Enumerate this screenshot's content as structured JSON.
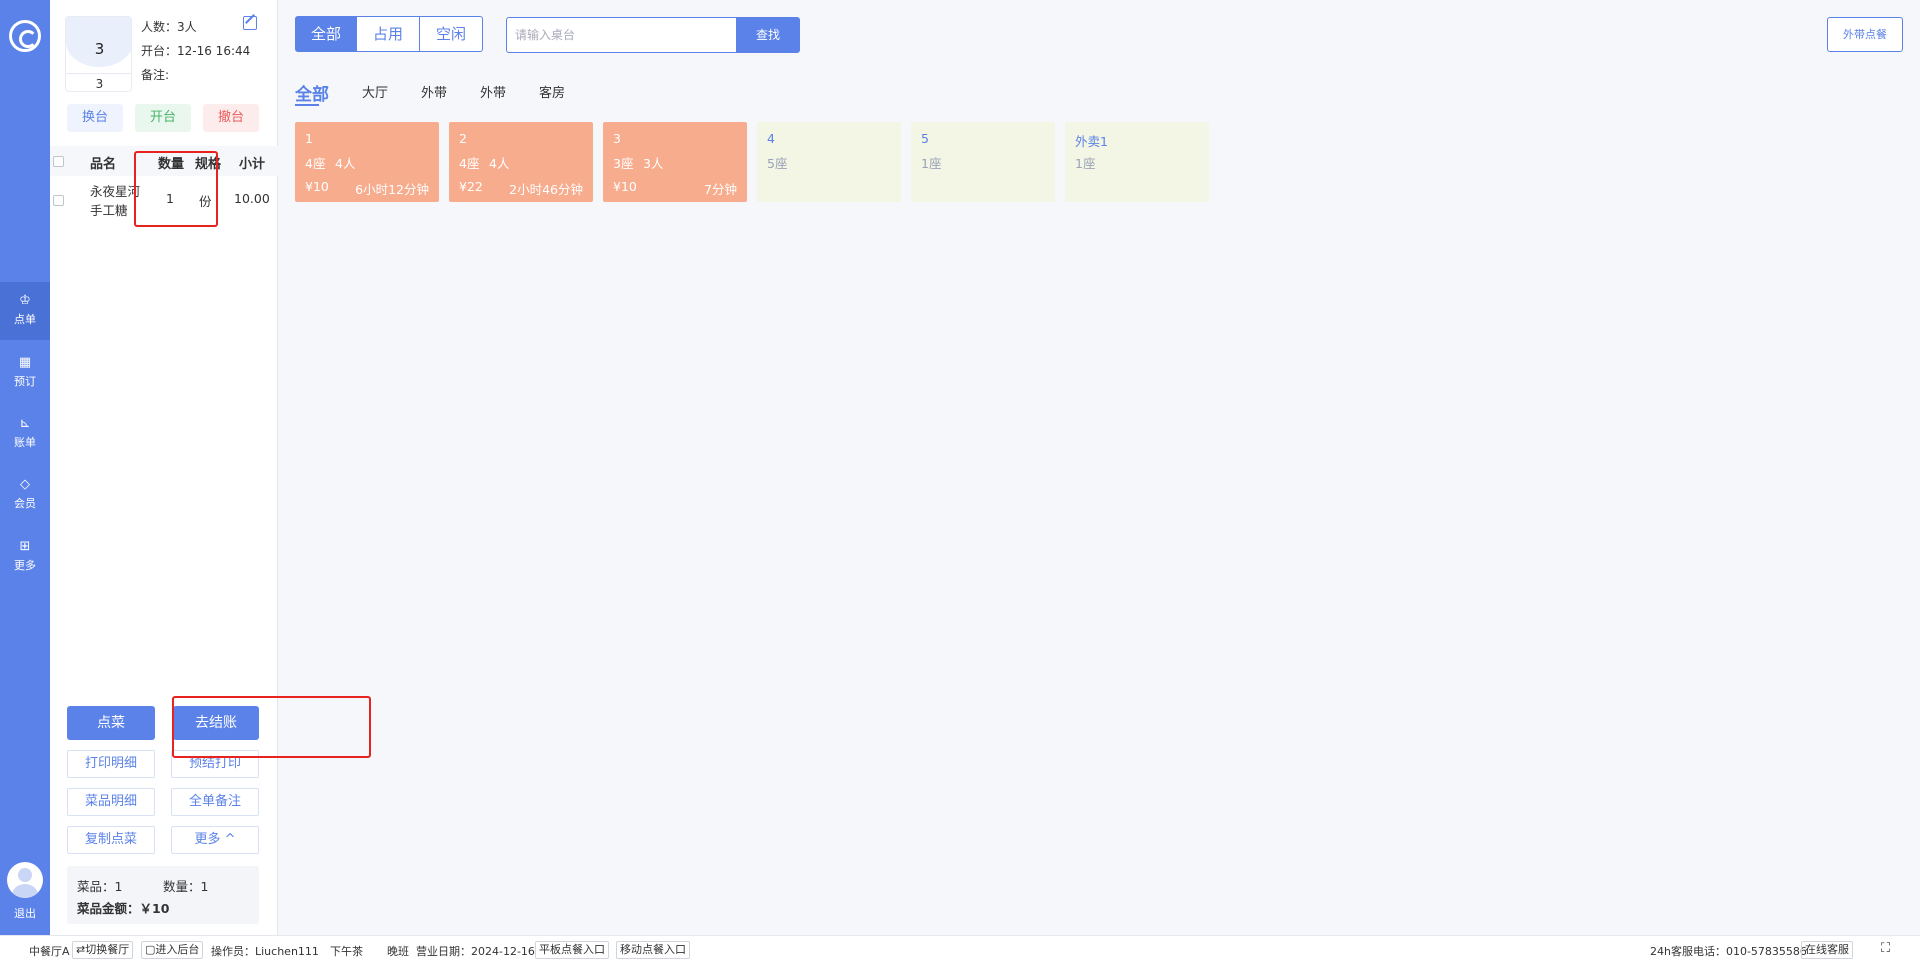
{
  "nav": {
    "items": [
      {
        "label": "点单",
        "icon": "chef-hat-icon"
      },
      {
        "label": "预订",
        "icon": "calendar-icon"
      },
      {
        "label": "账单",
        "icon": "chart-icon"
      },
      {
        "label": "会员",
        "icon": "diamond-icon"
      },
      {
        "label": "更多",
        "icon": "grid-icon"
      }
    ],
    "logout": "退出"
  },
  "order": {
    "table_no": "3",
    "table_no_sub": "3",
    "people": "人数：3人",
    "open_time": "开台：12-16 16:44",
    "note": "备注:",
    "btn_change": "换台",
    "btn_open": "开台",
    "btn_cancel": "撤台",
    "headers": {
      "name": "品名",
      "qty": "数量",
      "spec": "规格",
      "subtotal": "小计"
    },
    "rows": [
      {
        "name_line1": "永夜星河",
        "name_line2": "手工糖",
        "qty": "1",
        "spec": "份",
        "subtotal": "10.00"
      }
    ],
    "btn_order": "点菜",
    "btn_checkout": "去结账",
    "btn_print_detail": "打印明细",
    "btn_pre_print": "预结打印",
    "btn_dish_detail": "菜品明细",
    "btn_full_note": "全单备注",
    "btn_copy": "复制点菜",
    "btn_more": "更多 ^",
    "summary_dishes": "菜品：1",
    "summary_qty": "数量：1",
    "summary_amount": "菜品金额：￥10"
  },
  "main": {
    "filters": [
      "全部",
      "占用",
      "空闲"
    ],
    "search_placeholder": "请输入桌台",
    "search_btn": "查找",
    "takeaway_btn": "外带点餐",
    "tabs": [
      "全部",
      "大厅",
      "外带",
      "外带",
      "客房"
    ],
    "tables": [
      {
        "name": "1",
        "seats": "4座",
        "people": "4人",
        "price": "¥10",
        "duration": "6小时12分钟",
        "status": "occupied"
      },
      {
        "name": "2",
        "seats": "4座",
        "people": "4人",
        "price": "¥22",
        "duration": "2小时46分钟",
        "status": "occupied"
      },
      {
        "name": "3",
        "seats": "3座",
        "people": "3人",
        "price": "¥10",
        "duration": "7分钟",
        "status": "occupied"
      },
      {
        "name": "4",
        "seats": "5座",
        "status": "free"
      },
      {
        "name": "5",
        "seats": "1座",
        "status": "free"
      },
      {
        "name": "外卖1",
        "seats": "1座",
        "status": "free"
      }
    ]
  },
  "status": {
    "hall": "中餐厅A",
    "switch": "⇄切换餐厅",
    "backend": "▢进入后台",
    "operator": "操作员：Liuchen111",
    "shift1": "下午茶",
    "shift2": "晚班",
    "biz_date": "营业日期：2024-12-16",
    "tablet": "平板点餐入口",
    "mobile": "移动点餐入口",
    "hotline": "24h客服电话：010-57835586",
    "online": "在线客服"
  },
  "colors": {
    "primary": "#5b82e8",
    "occupied": "#f7ac8e",
    "free": "#f3f6e4",
    "annotation": "#e8231f"
  }
}
